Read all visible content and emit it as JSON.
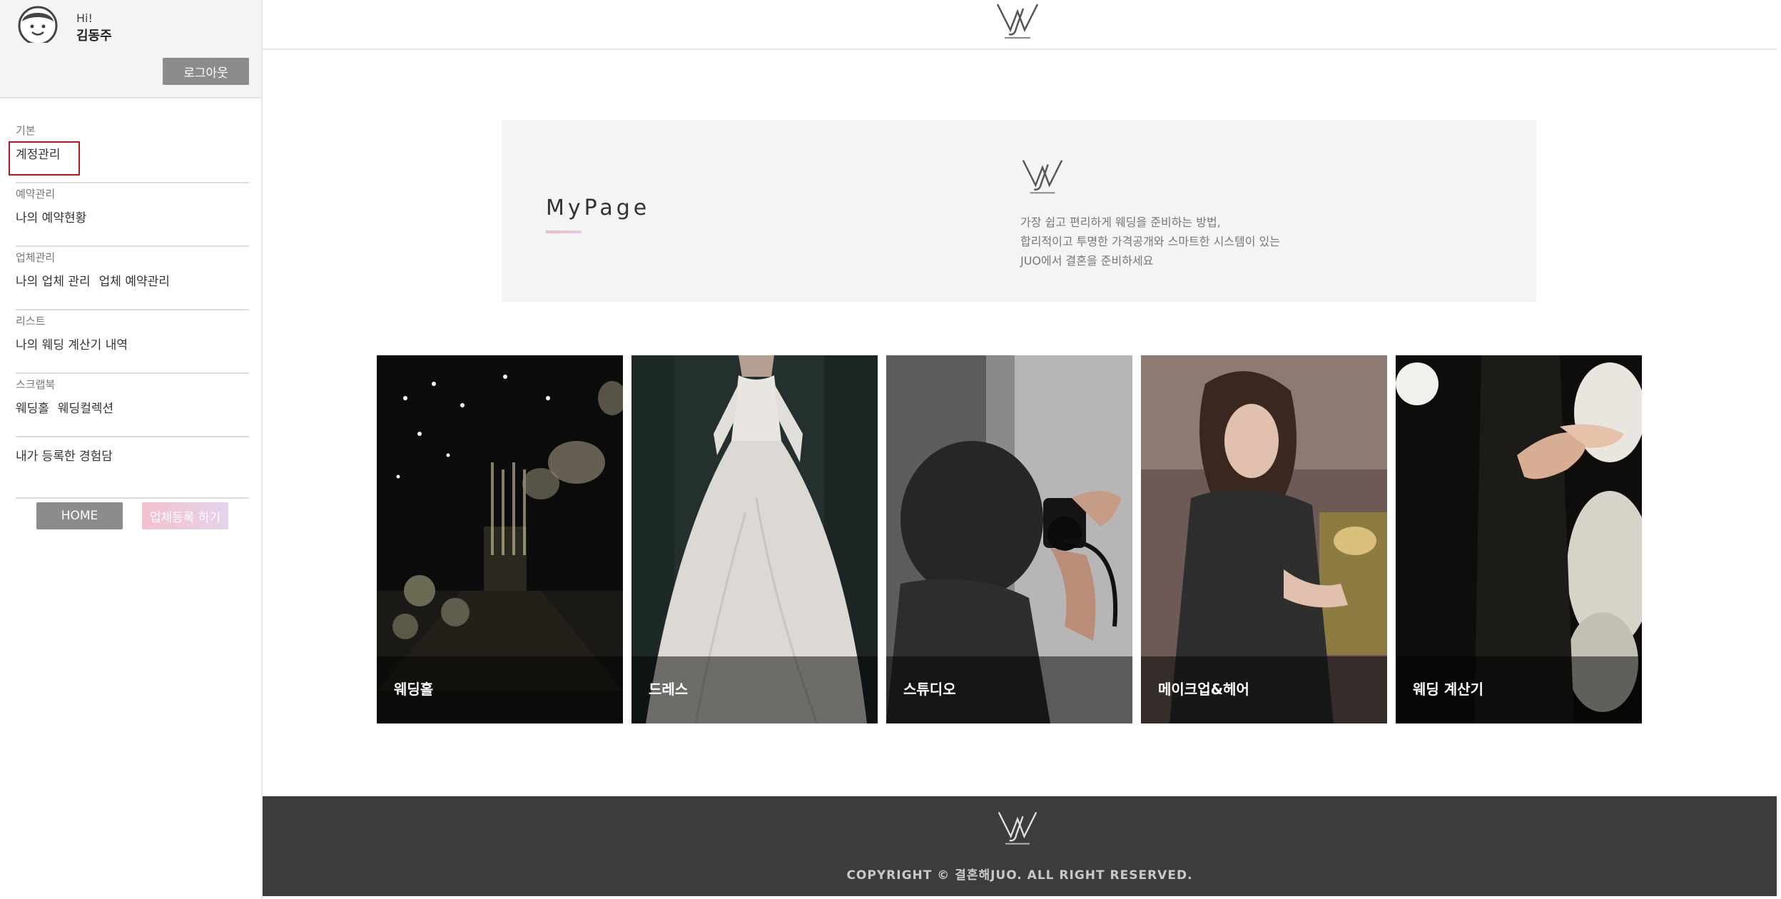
{
  "profile": {
    "greeting": "Hi!",
    "name": "김동주",
    "logout_label": "로그아웃"
  },
  "nav": [
    {
      "category": "기본",
      "items": [
        "계정관리"
      ]
    },
    {
      "category": "예약관리",
      "items": [
        "나의 예약현황"
      ]
    },
    {
      "category": "업체관리",
      "items": [
        "나의 업체 관리",
        "업체 예약관리"
      ]
    },
    {
      "category": "리스트",
      "items": [
        "나의 웨딩 계산기 내역"
      ]
    },
    {
      "category": "스크랩북",
      "items": [
        "웨딩홀",
        "웨딩컬렉션"
      ]
    },
    {
      "category": "",
      "items": [
        "내가 등록한 경험담"
      ]
    }
  ],
  "buttons": {
    "home": "HOME",
    "register": "업체등록 하기"
  },
  "banner": {
    "title": "MyPage",
    "lines": [
      "가장 쉽고 편리하게 웨딩을 준비하는 방법,",
      "합리적이고 투명한 가격공개와 스마트한 시스템이 있는",
      "JUO에서 결혼을 준비하세요"
    ]
  },
  "cards": [
    {
      "label": "웨딩홀",
      "icon": "wedding-hall-photo"
    },
    {
      "label": "드레스",
      "icon": "dress-photo"
    },
    {
      "label": "스튜디오",
      "icon": "studio-photo"
    },
    {
      "label": "메이크업&헤어",
      "icon": "makeup-photo"
    },
    {
      "label": "웨딩 계산기",
      "icon": "wedding-calculator-photo"
    }
  ],
  "footer": {
    "copyright": "COPYRIGHT © 결혼해JUO. ALL RIGHT RESERVED."
  },
  "colors": {
    "highlight_border": "#b11d1d",
    "accent_pink": "#f0b9c4",
    "footer_bg": "#3c3c3c"
  }
}
